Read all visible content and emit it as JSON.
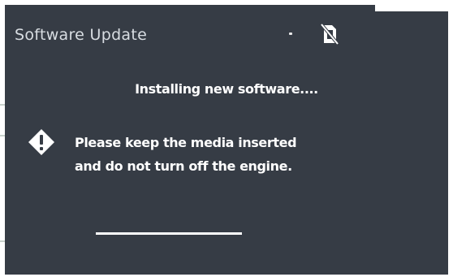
{
  "dialog": {
    "title": "Software Update",
    "status_text": "Installing new software....",
    "message_line1": "Please keep the media inserted",
    "message_line2": "and do not turn off the engine."
  },
  "icons": {
    "status": "no-media-card-icon",
    "warning": "warning-diamond-icon"
  },
  "progress": {
    "fraction": 1.0
  },
  "colors": {
    "background": "#363c45",
    "title_text": "#d8dde2",
    "text": "#ffffff",
    "progress": "#ffffff"
  }
}
